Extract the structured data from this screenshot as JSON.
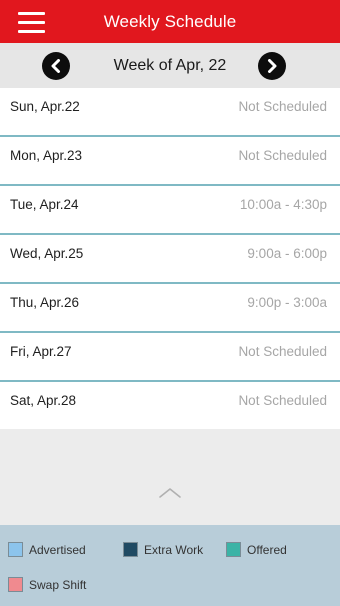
{
  "header": {
    "title": "Weekly Schedule",
    "menu_icon": "hamburger-menu-icon"
  },
  "week_nav": {
    "label": "Week of Apr, 22",
    "prev_icon": "chevron-left-icon",
    "next_icon": "chevron-right-icon"
  },
  "schedule": [
    {
      "day": "Sun, Apr.22",
      "shift": "Not Scheduled"
    },
    {
      "day": "Mon, Apr.23",
      "shift": "Not Scheduled"
    },
    {
      "day": "Tue, Apr.24",
      "shift": "10:00a - 4:30p"
    },
    {
      "day": "Wed, Apr.25",
      "shift": "9:00a - 6:00p"
    },
    {
      "day": "Thu, Apr.26",
      "shift": "9:00p - 3:00a"
    },
    {
      "day": "Fri, Apr.27",
      "shift": "Not Scheduled"
    },
    {
      "day": "Sat, Apr.28",
      "shift": "Not Scheduled"
    }
  ],
  "legend": [
    {
      "label": "Advertised",
      "color": "#8cc4ec"
    },
    {
      "label": "Extra Work",
      "color": "#1f4a63"
    },
    {
      "label": "Offered",
      "color": "#3bb3a6"
    },
    {
      "label": "Swap Shift",
      "color": "#f08a8f"
    }
  ],
  "colors": {
    "header_bg": "#e1171e",
    "row_divider": "#7fb9c4",
    "legend_bg": "#b8cdd9"
  }
}
